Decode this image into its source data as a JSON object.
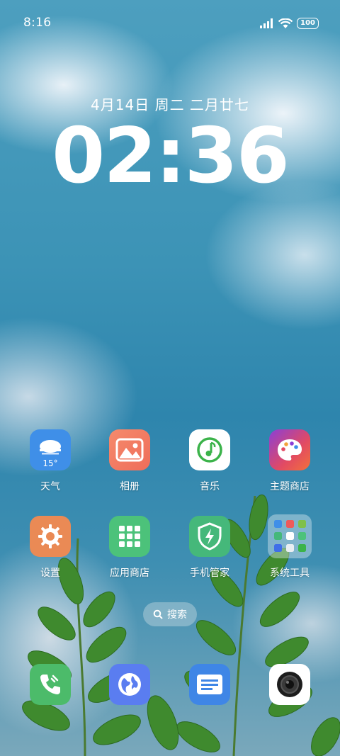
{
  "status_bar": {
    "time": "8:16",
    "battery": "100"
  },
  "lockscreen": {
    "date": "4月14日 周二 二月廿七",
    "clock": "02:36"
  },
  "apps": [
    {
      "label": "天气",
      "temp": "15°"
    },
    {
      "label": "相册"
    },
    {
      "label": "音乐"
    },
    {
      "label": "主题商店"
    },
    {
      "label": "设置"
    },
    {
      "label": "应用商店"
    },
    {
      "label": "手机管家"
    },
    {
      "label": "系统工具"
    }
  ],
  "search": {
    "label": "搜索"
  },
  "dock": [
    "phone-icon",
    "browser-icon",
    "messages-icon",
    "camera-icon"
  ]
}
